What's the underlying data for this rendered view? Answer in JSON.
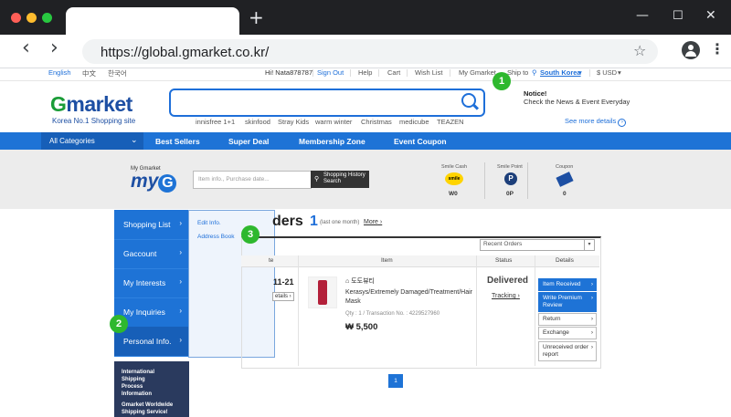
{
  "browser": {
    "url": "https://global.gmarket.co.kr/",
    "new_tab": "+",
    "win_minimize": "—",
    "win_maximize": "☐",
    "win_close": "✕",
    "back": "‹",
    "forward": "›",
    "star": "☆",
    "menu": "⋮"
  },
  "util": {
    "lang_en": "English",
    "lang_zh": "中文",
    "lang_ko": "한국어",
    "greeting": "Hi! Nata878787",
    "signout": "Sign Out",
    "help": "Help",
    "cart": "Cart",
    "wishlist": "Wish List",
    "mygmarket": "My Gmarket",
    "shipto": "Ship to",
    "country": "South Korea",
    "currency": "$ USD"
  },
  "header": {
    "logo_g": "G",
    "logo_rest": "market",
    "tagline": "Korea No.1 Shopping site",
    "search_placeholder": "",
    "tags": [
      "innisfree 1+1",
      "skinfood",
      "Stray Kids",
      "warm winter",
      "Christmas",
      "medicube",
      "TEAZEN"
    ],
    "notice_title": "Notice!",
    "notice_text": "Check the News & Event Everyday",
    "see_more": "See more details"
  },
  "nav": {
    "all_categories": "All Categories",
    "items": [
      "Best Sellers",
      "Super Deal",
      "Membership Zone",
      "Event Coupon"
    ]
  },
  "myg": {
    "small": "My Gmarket",
    "logo": "my",
    "logo_g": "G",
    "input_placeholder": "Item info., Purchase date...",
    "history_btn": "Shopping History Search",
    "smile_cash_label": "Smile Cash",
    "smile_cash_icon": "smile",
    "smile_cash_value": "W0",
    "smile_point_label": "Smile Point",
    "smile_point_icon": "P",
    "smile_point_value": "0P",
    "coupon_label": "Coupon",
    "coupon_value": "0"
  },
  "sidebar": {
    "items": [
      "Shopping List",
      "Gaccount",
      "My Interests",
      "My Inquiries",
      "Personal Info."
    ],
    "flyout": [
      "Edit Info.",
      "Address Book"
    ],
    "banner": [
      "International",
      "Shipping",
      "Process",
      "Information",
      "",
      "Gmarket Worldwide",
      "Shipping Service!"
    ]
  },
  "orders": {
    "title": "ders",
    "count": "1",
    "subtitle": "(last one month)",
    "more": "More",
    "filter": "Recent Orders",
    "columns": [
      "te",
      "Item",
      "Status",
      "Details"
    ],
    "date": "11-21",
    "details_btn": "etails",
    "shop": "도도뷰티",
    "product_name": "Kerasys/Extremely Damaged/Treatment/Hair Mask",
    "qty": "Qty : 1 / Transaction No. : 4229527960",
    "price": "₩ 5,500",
    "status": "Delivered",
    "tracking": "Tracking",
    "actions": [
      "Item Received",
      "Write Premium Review",
      "Return",
      "Exchange",
      "Unreceived order report"
    ],
    "page": "1"
  },
  "badges": [
    "1",
    "2",
    "3"
  ]
}
